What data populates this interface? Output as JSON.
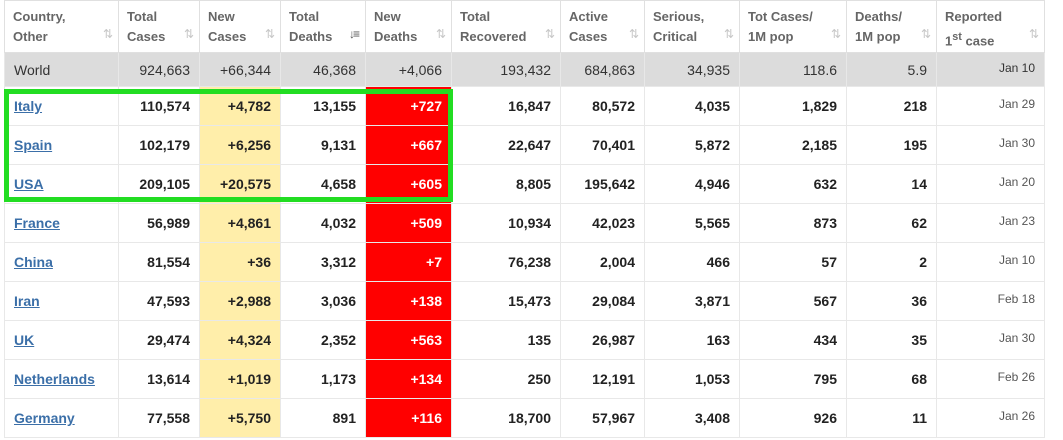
{
  "headers": [
    {
      "line1": "Country,",
      "line2": "Other",
      "sort": "⇅"
    },
    {
      "line1": "Total",
      "line2": "Cases",
      "sort": "⇅"
    },
    {
      "line1": "New",
      "line2": "Cases",
      "sort": "⇅"
    },
    {
      "line1": "Total",
      "line2": "Deaths",
      "sort": "↓≡"
    },
    {
      "line1": "New",
      "line2": "Deaths",
      "sort": "⇅"
    },
    {
      "line1": "Total",
      "line2": "Recovered",
      "sort": "⇅"
    },
    {
      "line1": "Active",
      "line2": "Cases",
      "sort": "⇅"
    },
    {
      "line1": "Serious,",
      "line2": "Critical",
      "sort": "⇅"
    },
    {
      "line1": "Tot Cases/",
      "line2": "1M pop",
      "sort": "⇅"
    },
    {
      "line1": "Deaths/",
      "line2": "1M pop",
      "sort": "⇅"
    },
    {
      "line1": "Reported",
      "line2a": "1",
      "line2sup": "st",
      "line2b": " case",
      "sort": "⇅"
    }
  ],
  "rows": [
    {
      "country": "World",
      "total_cases": "924,663",
      "new_cases": "+66,344",
      "total_deaths": "46,368",
      "new_deaths": "+4,066",
      "total_recovered": "193,432",
      "active_cases": "684,863",
      "serious": "34,935",
      "cases_per_1m": "118.6",
      "deaths_per_1m": "5.9",
      "first_case": "Jan 10"
    },
    {
      "country": "Italy",
      "total_cases": "110,574",
      "new_cases": "+4,782",
      "total_deaths": "13,155",
      "new_deaths": "+727",
      "total_recovered": "16,847",
      "active_cases": "80,572",
      "serious": "4,035",
      "cases_per_1m": "1,829",
      "deaths_per_1m": "218",
      "first_case": "Jan 29"
    },
    {
      "country": "Spain",
      "total_cases": "102,179",
      "new_cases": "+6,256",
      "total_deaths": "9,131",
      "new_deaths": "+667",
      "total_recovered": "22,647",
      "active_cases": "70,401",
      "serious": "5,872",
      "cases_per_1m": "2,185",
      "deaths_per_1m": "195",
      "first_case": "Jan 30"
    },
    {
      "country": "USA",
      "total_cases": "209,105",
      "new_cases": "+20,575",
      "total_deaths": "4,658",
      "new_deaths": "+605",
      "total_recovered": "8,805",
      "active_cases": "195,642",
      "serious": "4,946",
      "cases_per_1m": "632",
      "deaths_per_1m": "14",
      "first_case": "Jan 20"
    },
    {
      "country": "France",
      "total_cases": "56,989",
      "new_cases": "+4,861",
      "total_deaths": "4,032",
      "new_deaths": "+509",
      "total_recovered": "10,934",
      "active_cases": "42,023",
      "serious": "5,565",
      "cases_per_1m": "873",
      "deaths_per_1m": "62",
      "first_case": "Jan 23"
    },
    {
      "country": "China",
      "total_cases": "81,554",
      "new_cases": "+36",
      "total_deaths": "3,312",
      "new_deaths": "+7",
      "total_recovered": "76,238",
      "active_cases": "2,004",
      "serious": "466",
      "cases_per_1m": "57",
      "deaths_per_1m": "2",
      "first_case": "Jan 10"
    },
    {
      "country": "Iran",
      "total_cases": "47,593",
      "new_cases": "+2,988",
      "total_deaths": "3,036",
      "new_deaths": "+138",
      "total_recovered": "15,473",
      "active_cases": "29,084",
      "serious": "3,871",
      "cases_per_1m": "567",
      "deaths_per_1m": "36",
      "first_case": "Feb 18"
    },
    {
      "country": "UK",
      "total_cases": "29,474",
      "new_cases": "+4,324",
      "total_deaths": "2,352",
      "new_deaths": "+563",
      "total_recovered": "135",
      "active_cases": "26,987",
      "serious": "163",
      "cases_per_1m": "434",
      "deaths_per_1m": "35",
      "first_case": "Jan 30"
    },
    {
      "country": "Netherlands",
      "total_cases": "13,614",
      "new_cases": "+1,019",
      "total_deaths": "1,173",
      "new_deaths": "+134",
      "total_recovered": "250",
      "active_cases": "12,191",
      "serious": "1,053",
      "cases_per_1m": "795",
      "deaths_per_1m": "68",
      "first_case": "Feb 26"
    },
    {
      "country": "Germany",
      "total_cases": "77,558",
      "new_cases": "+5,750",
      "total_deaths": "891",
      "new_deaths": "+116",
      "total_recovered": "18,700",
      "active_cases": "57,967",
      "serious": "3,408",
      "cases_per_1m": "926",
      "deaths_per_1m": "11",
      "first_case": "Jan 26"
    }
  ],
  "colors": {
    "new_cases_bg": "#ffeeaa",
    "new_deaths_bg": "#ff0000",
    "world_bg": "#dcdcdc",
    "highlight": "#22dd22",
    "link": "#3b6fa8"
  },
  "icons": {
    "sort": "sort-icon",
    "sort_active": "sort-desc-icon"
  }
}
